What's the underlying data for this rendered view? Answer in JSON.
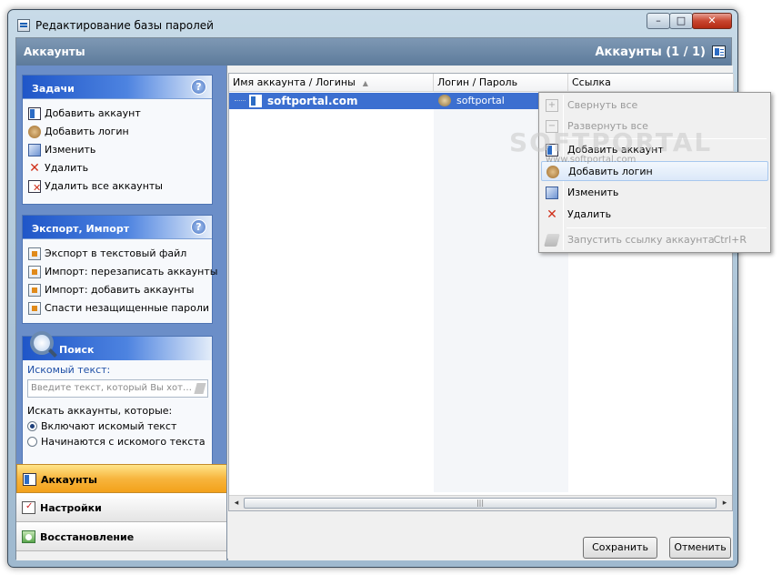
{
  "window": {
    "title": "Редактирование базы паролей",
    "min": "–",
    "max": "□",
    "close": "✕"
  },
  "header": {
    "left_title": "Аккаунты",
    "right_title": "Аккаунты (1 / 1)"
  },
  "tasks": {
    "title": "Задачи",
    "help": "?",
    "items": [
      "Добавить аккаунт",
      "Добавить логин",
      "Изменить",
      "Удалить",
      "Удалить все аккаунты"
    ]
  },
  "export": {
    "title": "Экспорт, Импорт",
    "help": "?",
    "items": [
      "Экспорт в текстовый файл",
      "Импорт: перезаписать аккаунты",
      "Импорт: добавить аккаунты",
      "Спасти незащищенные пароли"
    ]
  },
  "search": {
    "title": "Поиск",
    "label": "Искомый текст:",
    "placeholder": "Введите текст, который Вы хот…",
    "filter_label": "Искать аккаунты, которые:",
    "options": [
      "Включают искомый текст",
      "Начинаются с искомого текста"
    ],
    "selected": 0
  },
  "nav": {
    "items": [
      "Аккаунты",
      "Настройки",
      "Восстановление"
    ],
    "active": 0
  },
  "grid": {
    "columns": [
      "Имя аккаунта / Логины",
      "Логин / Пароль",
      "Ссылка"
    ],
    "sort_indicator": "▲",
    "rows": [
      {
        "name": "softportal.com",
        "login": "softportal",
        "link": ""
      }
    ]
  },
  "scroll": {
    "left": "◂",
    "right": "▸",
    "grip": "|||"
  },
  "buttons": {
    "save": "Сохранить",
    "cancel": "Отменить"
  },
  "context_menu": {
    "items": [
      {
        "label": "Свернуть все",
        "enabled": false,
        "icon": "expand-plus-icon"
      },
      {
        "label": "Развернуть все",
        "enabled": false,
        "icon": "collapse-minus-icon"
      },
      {
        "label": "Добавить аккаунт",
        "enabled": true,
        "icon": "account-card-icon"
      },
      {
        "label": "Добавить логин",
        "enabled": true,
        "highlighted": true,
        "icon": "login-user-icon"
      },
      {
        "label": "Изменить",
        "enabled": true,
        "icon": "edit-icon"
      },
      {
        "label": "Удалить",
        "enabled": true,
        "icon": "delete-x-icon"
      },
      {
        "label": "Запустить ссылку аккаунта",
        "enabled": false,
        "shortcut": "Ctrl+R",
        "icon": "link-icon"
      }
    ]
  },
  "watermark": {
    "brand": "SOFTPORTAL",
    "url": "www.softportal.com"
  },
  "colors": {
    "selection": "#3c6fd0",
    "panel_head": "#1f56c8",
    "active_nav": "#f7b53e",
    "close": "#c8452f"
  }
}
